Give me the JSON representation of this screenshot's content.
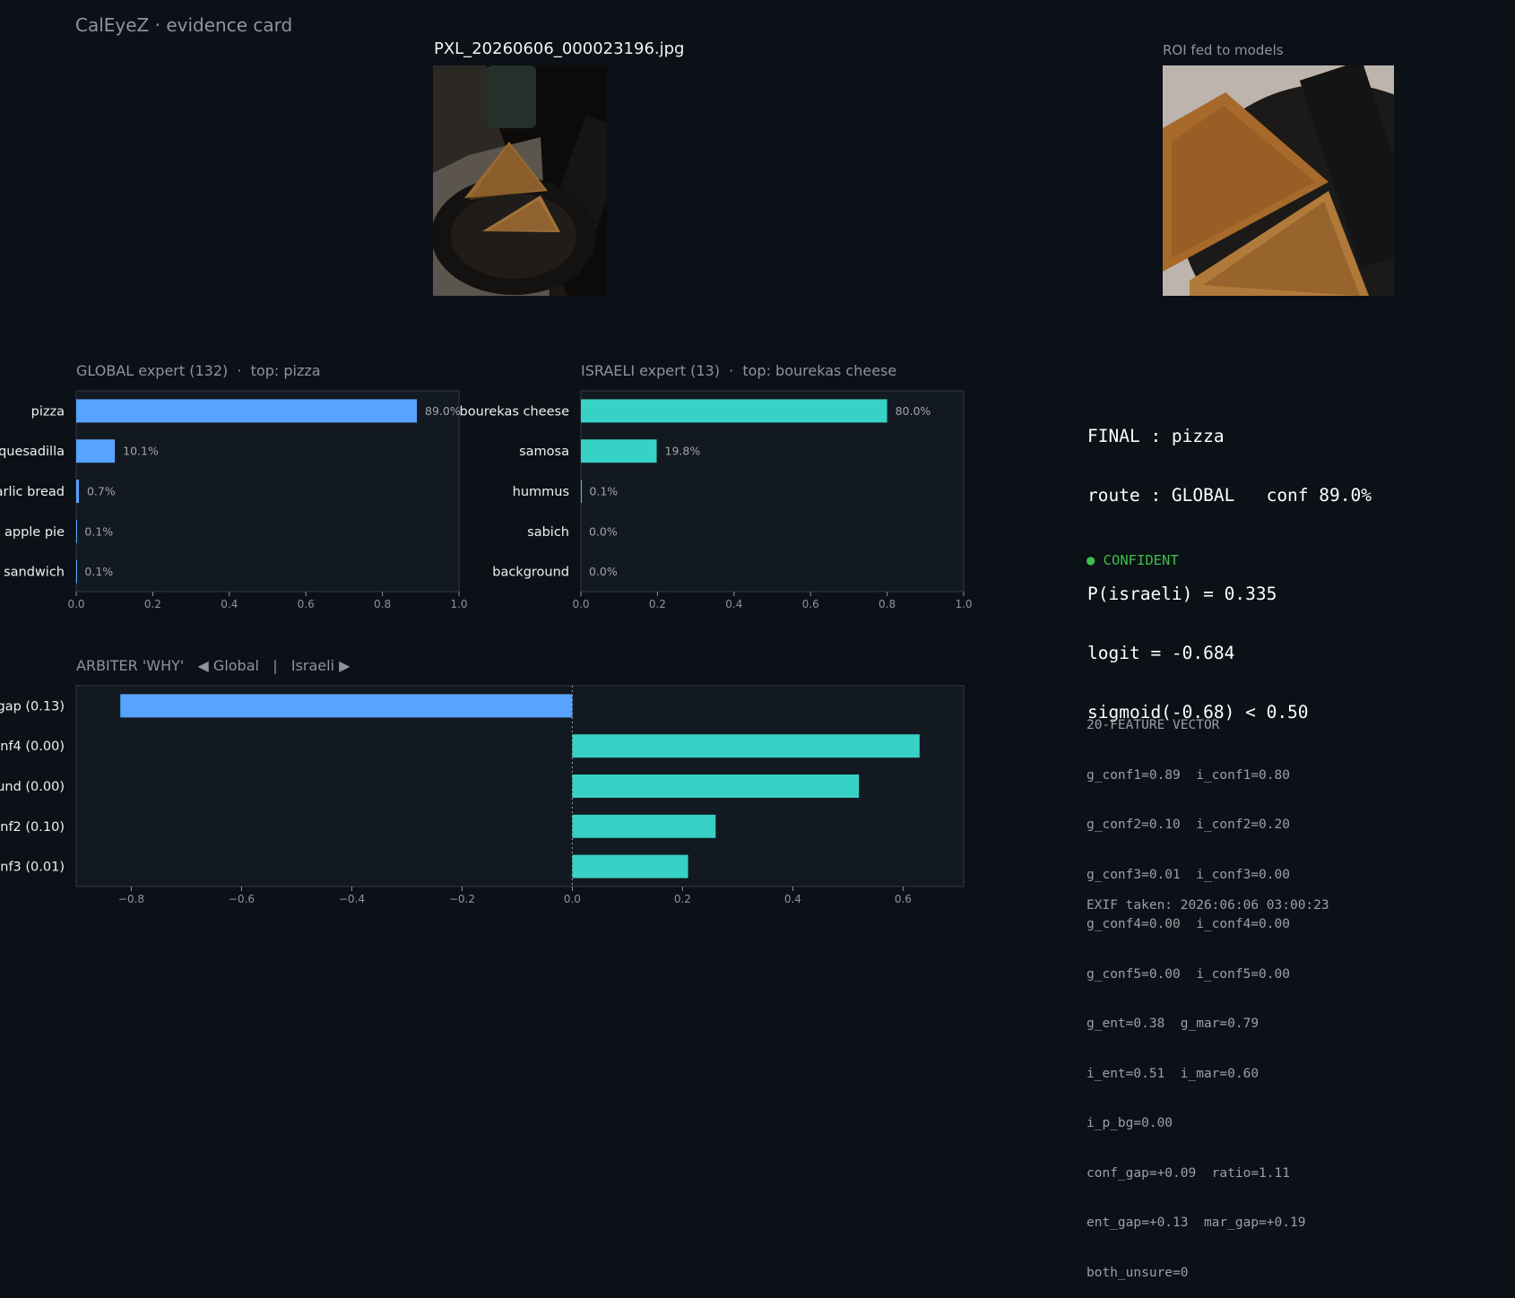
{
  "header": {
    "app_title": "CalEyeZ · evidence card",
    "photo_filename": "PXL_20260606_000023196.jpg",
    "roi_title": "ROI fed to models"
  },
  "images": {
    "photo": "pizza-slices-on-plate-photo",
    "roi": "pizza-slices-roi-crop"
  },
  "colors": {
    "background": "#0c1017",
    "panel": "#131920",
    "global_bar": "#57a3ff",
    "israeli_bar": "#37d1c5",
    "confident": "#3fbf4a"
  },
  "final": {
    "lines": [
      "FINAL : pizza",
      "route : GLOBAL   conf 89.0%",
      "",
      "P(israeli) = 0.335",
      "logit = -0.684",
      "sigmoid(-0.68) < 0.50"
    ],
    "status": "● CONFIDENT"
  },
  "features": {
    "title": "20-FEATURE VECTOR",
    "lines": [
      "g_conf1=0.89  i_conf1=0.80",
      "g_conf2=0.10  i_conf2=0.20",
      "g_conf3=0.01  i_conf3=0.00",
      "g_conf4=0.00  i_conf4=0.00",
      "g_conf5=0.00  i_conf5=0.00",
      "g_ent=0.38  g_mar=0.79",
      "i_ent=0.51  i_mar=0.60",
      "i_p_bg=0.00",
      "conf_gap=+0.09  ratio=1.11",
      "ent_gap=+0.13  mar_gap=+0.19",
      "both_unsure=0"
    ],
    "exif": "EXIF taken: 2026:06:06 03:00:23"
  },
  "chart_data": [
    {
      "type": "bar",
      "orientation": "horizontal",
      "title": "GLOBAL expert (132)  ·  top: pizza",
      "categories": [
        "pizza",
        "quesadilla",
        "garlic bread",
        "apple pie",
        "sandwich"
      ],
      "values": [
        0.89,
        0.101,
        0.007,
        0.001,
        0.001
      ],
      "value_labels": [
        "89.0%",
        "10.1%",
        "0.7%",
        "0.1%",
        "0.1%"
      ],
      "xlim": [
        0,
        1
      ],
      "xticks": [
        "0.0",
        "0.2",
        "0.4",
        "0.6",
        "0.8",
        "1.0"
      ],
      "color": "#57a3ff"
    },
    {
      "type": "bar",
      "orientation": "horizontal",
      "title": "ISRAELI expert (13)  ·  top: bourekas cheese",
      "categories": [
        "bourekas cheese",
        "samosa",
        "hummus",
        "sabich",
        "background"
      ],
      "values": [
        0.8,
        0.198,
        0.001,
        0.0,
        0.0
      ],
      "value_labels": [
        "80.0%",
        "19.8%",
        "0.1%",
        "0.0%",
        "0.0%"
      ],
      "xlim": [
        0,
        1
      ],
      "xticks": [
        "0.0",
        "0.2",
        "0.4",
        "0.6",
        "0.8",
        "1.0"
      ],
      "color": "#37d1c5"
    },
    {
      "type": "bar",
      "orientation": "horizontal",
      "title": "ARBITER 'WHY'   ◀ Global   |   Israeli ▶",
      "categories": [
        "gap (0.13)",
        "onf4 (0.00)",
        "und (0.00)",
        "onf2 (0.10)",
        "onf3 (0.01)"
      ],
      "values": [
        -0.82,
        0.63,
        0.52,
        0.26,
        0.21
      ],
      "xlim": [
        -0.9,
        0.71
      ],
      "xticks": [
        -0.8,
        -0.6,
        -0.4,
        -0.2,
        0.0,
        0.2,
        0.4,
        0.6
      ],
      "xtick_labels": [
        "−0.8",
        "−0.6",
        "−0.4",
        "−0.2",
        "0.0",
        "0.2",
        "0.4",
        "0.6"
      ],
      "colors": {
        "negative": "#57a3ff",
        "positive": "#37d1c5"
      }
    }
  ]
}
